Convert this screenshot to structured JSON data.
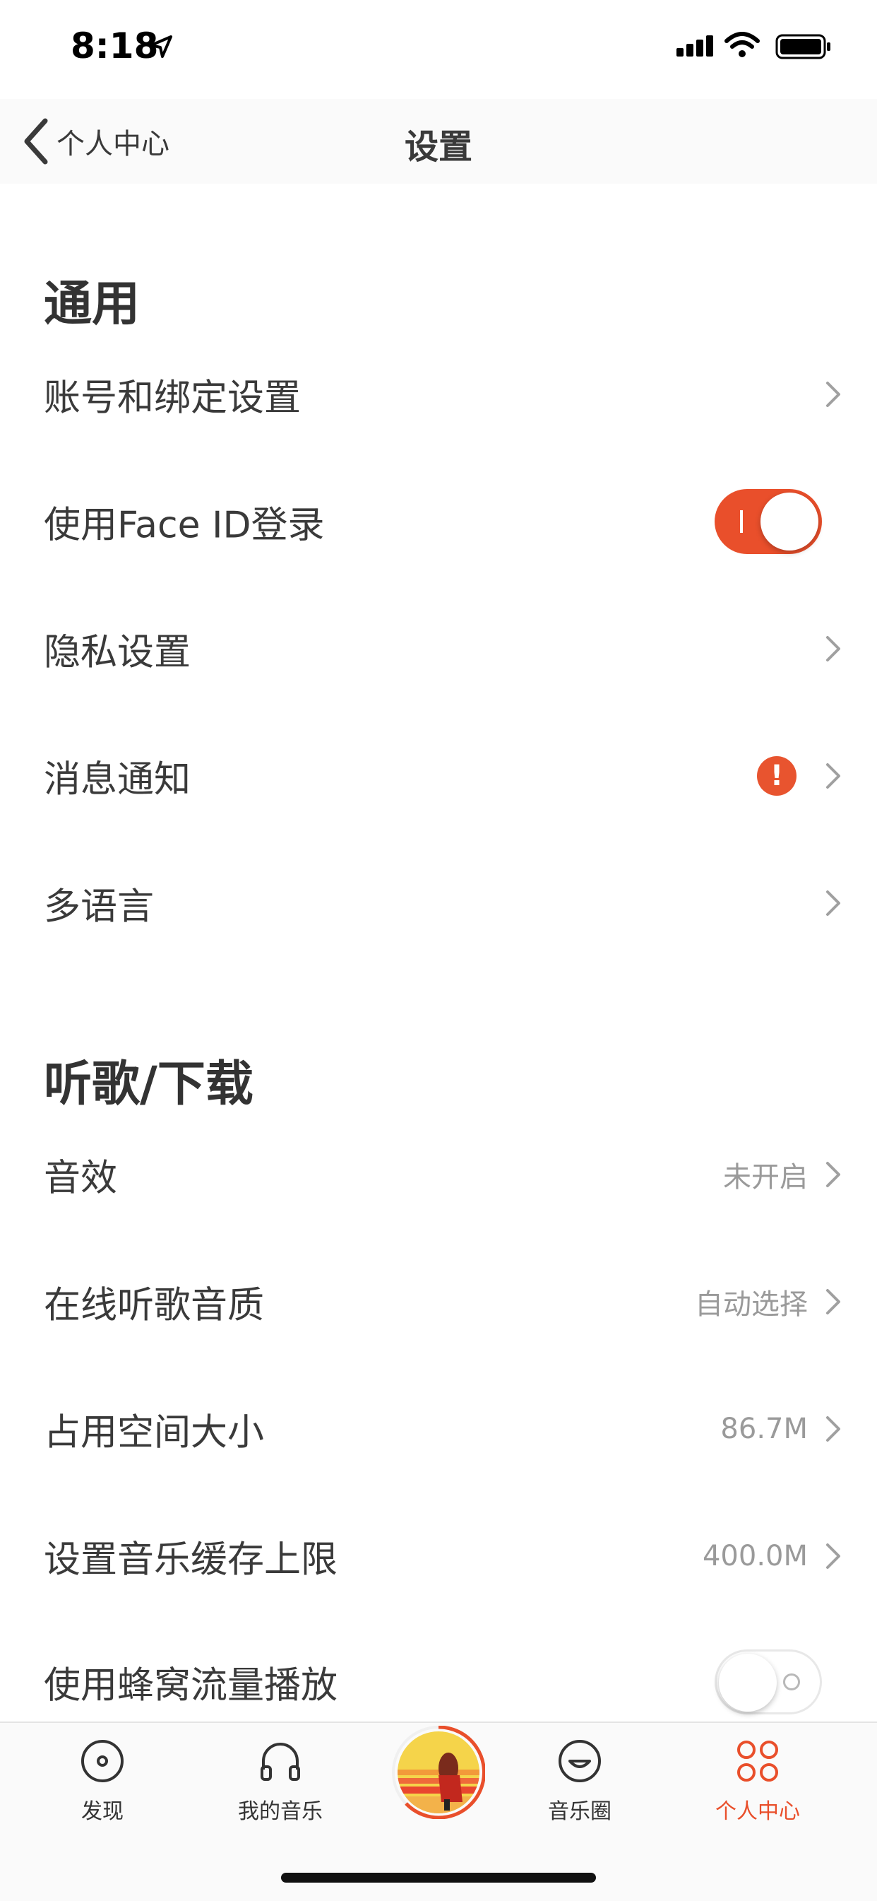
{
  "status": {
    "time": "8:18"
  },
  "nav": {
    "back_label": "个人中心",
    "title": "设置"
  },
  "sections": [
    {
      "title": "通用",
      "rows": [
        {
          "label": "账号和绑定设置"
        },
        {
          "label": "使用Face ID登录",
          "toggle": true
        },
        {
          "label": "隐私设置"
        },
        {
          "label": "消息通知",
          "badge": "!"
        },
        {
          "label": "多语言"
        }
      ]
    },
    {
      "title": "听歌/下载",
      "rows": [
        {
          "label": "音效",
          "value": "未开启"
        },
        {
          "label": "在线听歌音质",
          "value": "自动选择"
        },
        {
          "label": "占用空间大小",
          "value": "86.7M"
        },
        {
          "label": "设置音乐缓存上限",
          "value": "400.0M"
        },
        {
          "label": "使用蜂窝流量播放",
          "toggle": false
        }
      ]
    }
  ],
  "tabs": [
    {
      "label": "发现",
      "icon": "disc-icon"
    },
    {
      "label": "我的音乐",
      "icon": "headphones-icon"
    },
    {
      "label": "音乐圈",
      "icon": "smile-icon"
    },
    {
      "label": "个人中心",
      "icon": "grid-icon",
      "active": true
    }
  ],
  "colors": {
    "accent": "#e94f2b",
    "text": "#3a3a3a",
    "secondary": "#9a9a9a"
  }
}
